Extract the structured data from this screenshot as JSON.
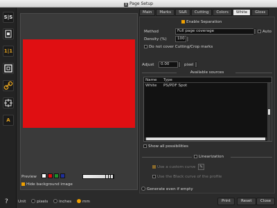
{
  "window": {
    "title": "Page Setup",
    "app_icon": "x-app-icon"
  },
  "sidebar": {
    "tools": [
      {
        "icon": "s2-icon",
        "label": "S|S"
      },
      {
        "icon": "page-layout-icon",
        "label": ""
      },
      {
        "icon": "one-one-icon",
        "label": "1|1"
      },
      {
        "icon": "frame-icon",
        "label": ""
      },
      {
        "icon": "link-icon",
        "label": ""
      },
      {
        "icon": "target-icon",
        "label": ""
      },
      {
        "icon": "text-a-icon",
        "label": "A"
      }
    ],
    "help": "?"
  },
  "preview": {
    "label": "Preview",
    "page_color": "#e00f12",
    "swatches": [
      "#ffffff",
      "#e00f12",
      "#1f8f2a",
      "#1f2f9a"
    ],
    "hide_bg_label": "Hide background image",
    "hide_bg_checked": true
  },
  "units": {
    "label": "Unit",
    "options": [
      "pixels",
      "inches",
      "mm"
    ],
    "selected": "mm"
  },
  "tabs": [
    "Main",
    "Marks",
    "S&R",
    "Cutting",
    "Colors",
    "White",
    "Gloss"
  ],
  "active_tab": "White",
  "white": {
    "enable_label": "Enable Separation",
    "enable_checked": true,
    "method_label": "Method",
    "method_value": "Full page coverage",
    "auto_label": "Auto",
    "density_label": "Density (%)",
    "density_value": "100",
    "no_cover_label": "Do not cover Cutting/Crop marks",
    "adjust_label": "Adjust",
    "adjust_value": "0.00",
    "adjust_unit": "pixel",
    "sources_header": "Available sources",
    "sources_columns": [
      "Name",
      "Type"
    ],
    "sources_rows": [
      {
        "name": "White",
        "type": "PS/PDF Spot"
      }
    ],
    "show_all_label": "Show all possibilities",
    "linearization_label": "Linearization",
    "custom_curve_label": "Use a custom curve",
    "black_curve_label": "Use the Black curve of the profile",
    "generate_label": "Generate even if empty"
  },
  "buttons": {
    "print": "Print",
    "reset": "Reset",
    "close": "Close"
  }
}
